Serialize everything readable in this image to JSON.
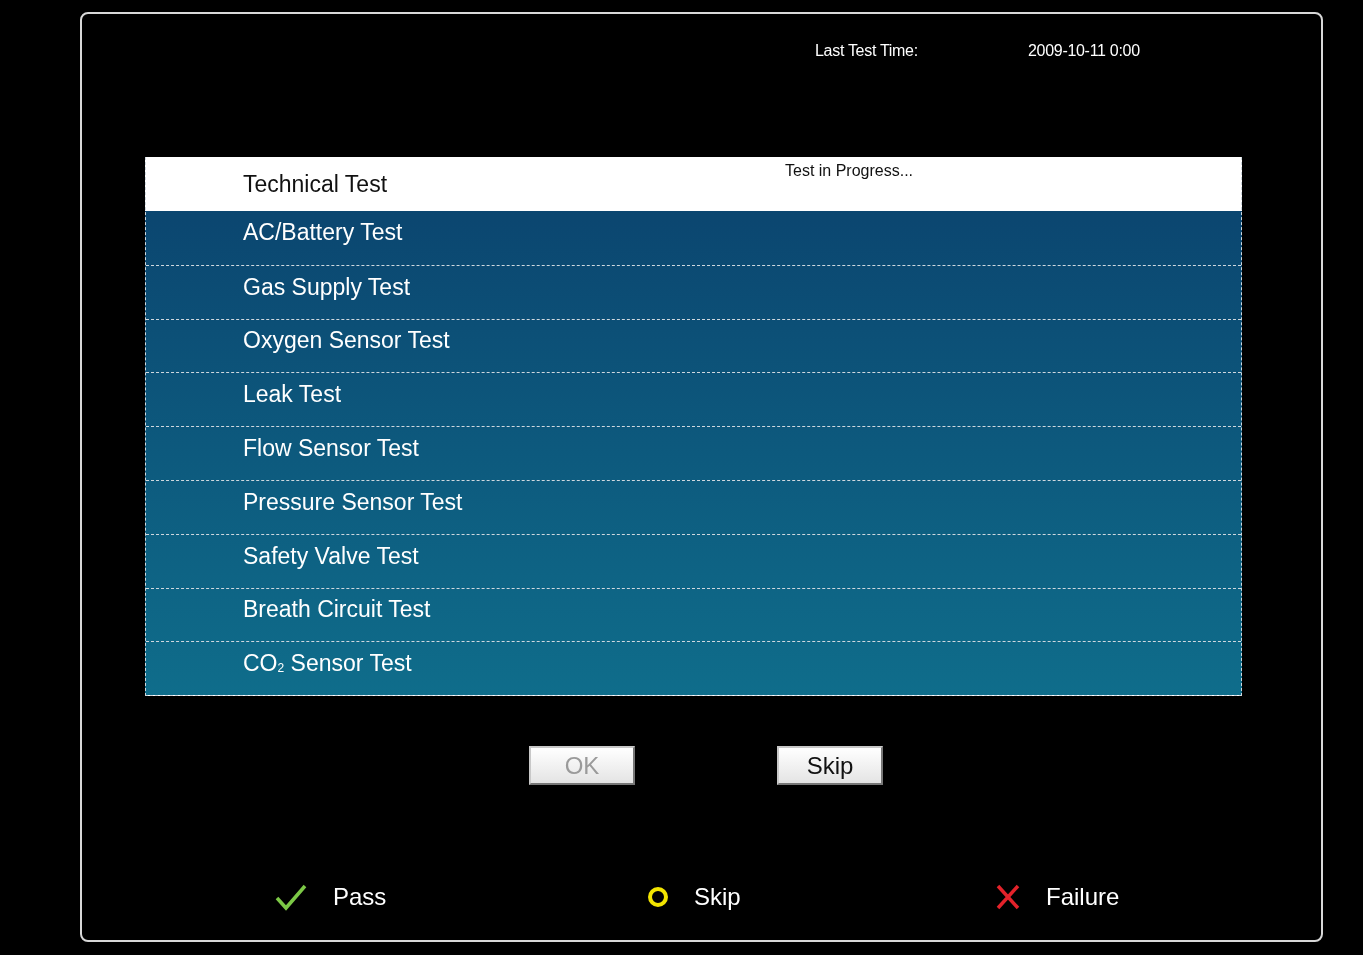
{
  "header": {
    "last_test_label": "Last Test Time:",
    "last_test_value": "2009-10-11 0:00"
  },
  "table": {
    "title": "Technical Test",
    "status": "Test in Progress...",
    "rows": [
      {
        "label": "AC/Battery Test"
      },
      {
        "label": "Gas Supply Test"
      },
      {
        "label": "Oxygen Sensor Test"
      },
      {
        "label": "Leak Test"
      },
      {
        "label": "Flow Sensor Test"
      },
      {
        "label": "Pressure Sensor Test"
      },
      {
        "label": "Safety Valve Test"
      },
      {
        "label": "Breath Circuit Test"
      },
      {
        "label": "CO$_{2}$ Sensor Test"
      }
    ]
  },
  "buttons": [
    {
      "label": "OK",
      "disabled": true
    },
    {
      "label": "Skip",
      "disabled": false
    }
  ],
  "legend": [
    {
      "kind": "pass",
      "label": "Pass"
    },
    {
      "kind": "skip",
      "label": "Skip"
    },
    {
      "kind": "failure",
      "label": "Failure"
    }
  ]
}
